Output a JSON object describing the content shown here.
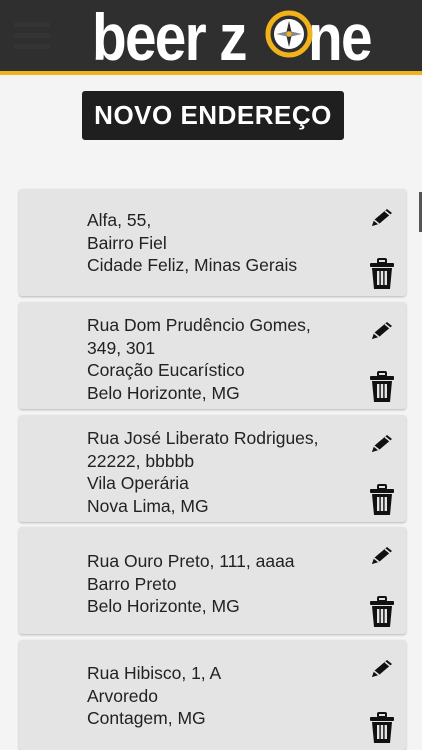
{
  "header": {
    "logo_text": "beer zone",
    "logo_part1": "beer z",
    "logo_part2": "ne"
  },
  "new_address_button": "NOVO ENDEREÇO",
  "addresses": [
    {
      "lines": [
        "Alfa, 55,",
        "Bairro Fiel",
        "Cidade Feliz, Minas Gerais"
      ]
    },
    {
      "lines": [
        "Rua Dom Prudêncio Gomes,",
        "349, 301",
        "Coração Eucarístico",
        "Belo Horizonte, MG"
      ]
    },
    {
      "lines": [
        "Rua José Liberato Rodrigues,",
        "22222, bbbbb",
        "Vila Operária",
        "Nova Lima, MG"
      ]
    },
    {
      "lines": [
        "Rua Ouro Preto, 111, aaaa",
        "Barro Preto",
        "Belo Horizonte, MG"
      ]
    },
    {
      "lines": [
        "Rua Hibisco, 1, A",
        "Arvoredo",
        "Contagem, MG"
      ]
    }
  ],
  "icons": {
    "edit": "pencil-icon",
    "delete": "trash-icon"
  },
  "colors": {
    "header_bg": "#2f2f2f",
    "accent": "#f2b21b",
    "button_bg": "#1f1f1f",
    "card_bg": "#e4e4e4"
  }
}
